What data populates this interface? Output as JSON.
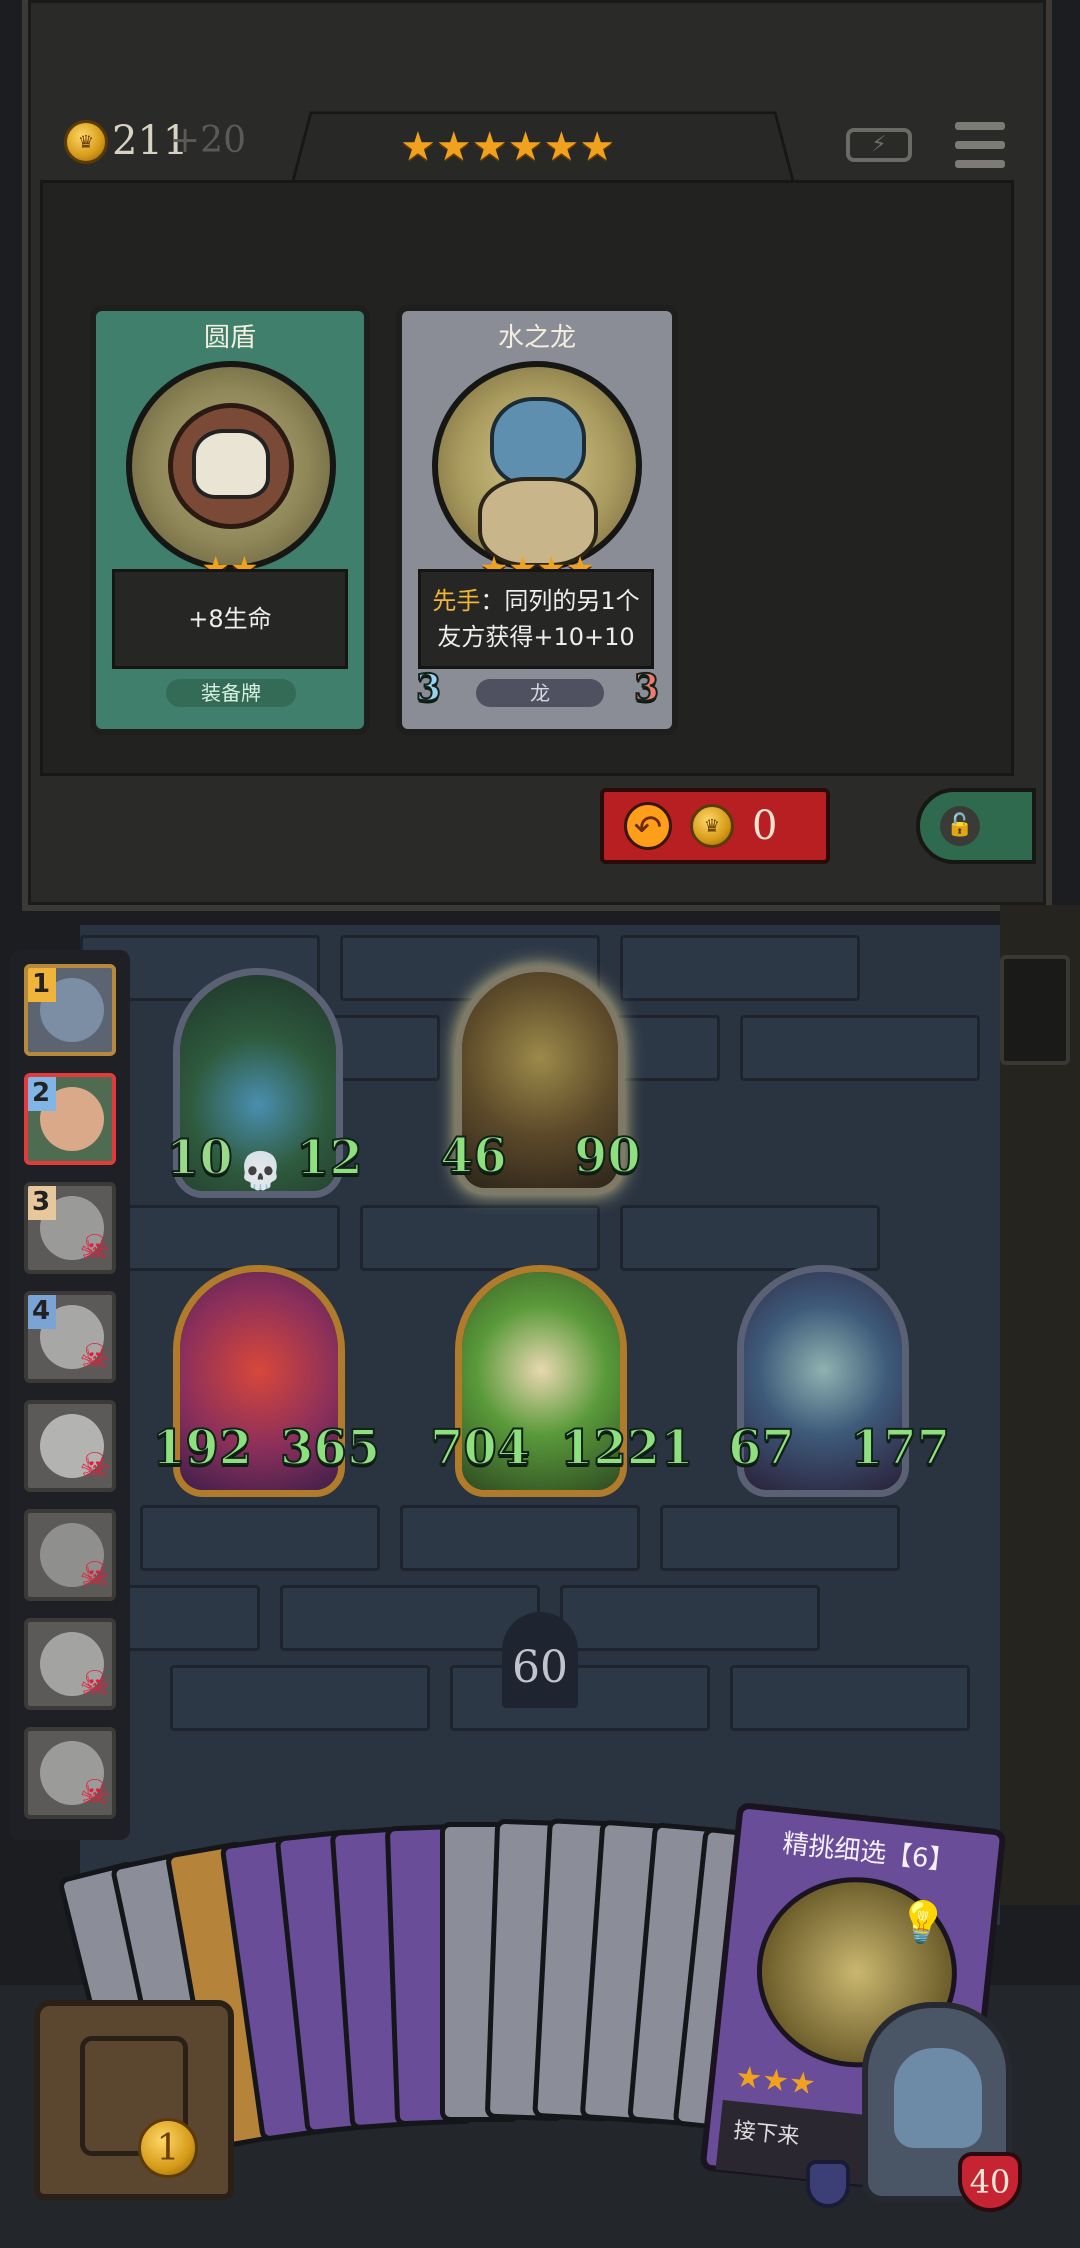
{
  "header": {
    "gold": "211",
    "gold_income": "+20",
    "tier_stars": "★★★★★★",
    "battery_icon": "battery-charging-icon",
    "menu_icon": "hamburger-menu-icon"
  },
  "shop": {
    "cards": [
      {
        "title": "圆盾",
        "stars": "★★",
        "desc": "+8生命",
        "type": "装备牌",
        "color": "#3f7f6b"
      },
      {
        "title": "水之龙",
        "stars": "★★★★",
        "desc_keyword": "先手",
        "desc_rest": "：同列的另1个友方获得+10+10",
        "type": "龙",
        "attack": "3",
        "health": "3",
        "color": "#8a8c96"
      }
    ],
    "refresh_cost": "0"
  },
  "sidebar": {
    "slots": [
      {
        "badge": "1",
        "badge_color": "#f0b43a",
        "dead": false
      },
      {
        "badge": "2",
        "badge_color": "#7fb6e6",
        "dead": false,
        "active": true
      },
      {
        "badge": "3",
        "badge_color": "#e7c79c",
        "dead": true
      },
      {
        "badge": "4",
        "badge_color": "#7aa3d6",
        "dead": true
      },
      {
        "badge": "",
        "dead": true
      },
      {
        "badge": "",
        "dead": true
      },
      {
        "badge": "",
        "dead": true
      },
      {
        "badge": "",
        "dead": true
      }
    ]
  },
  "board": {
    "minions": [
      {
        "attack": "10",
        "health": "12",
        "frame": "silver"
      },
      {
        "attack": "46",
        "health": "90",
        "frame": "silver"
      },
      {
        "attack": "192",
        "health": "365",
        "frame": "gold"
      },
      {
        "attack": "704",
        "health": "1221",
        "frame": "gold"
      },
      {
        "attack": "67",
        "health": "177",
        "frame": "silver"
      }
    ],
    "timer": "60"
  },
  "hand": {
    "top_card_title": "精挑细选【6】",
    "top_card_stars": "★★★",
    "top_card_desc": "接下来",
    "chest_count": "1",
    "hero_health": "40"
  }
}
